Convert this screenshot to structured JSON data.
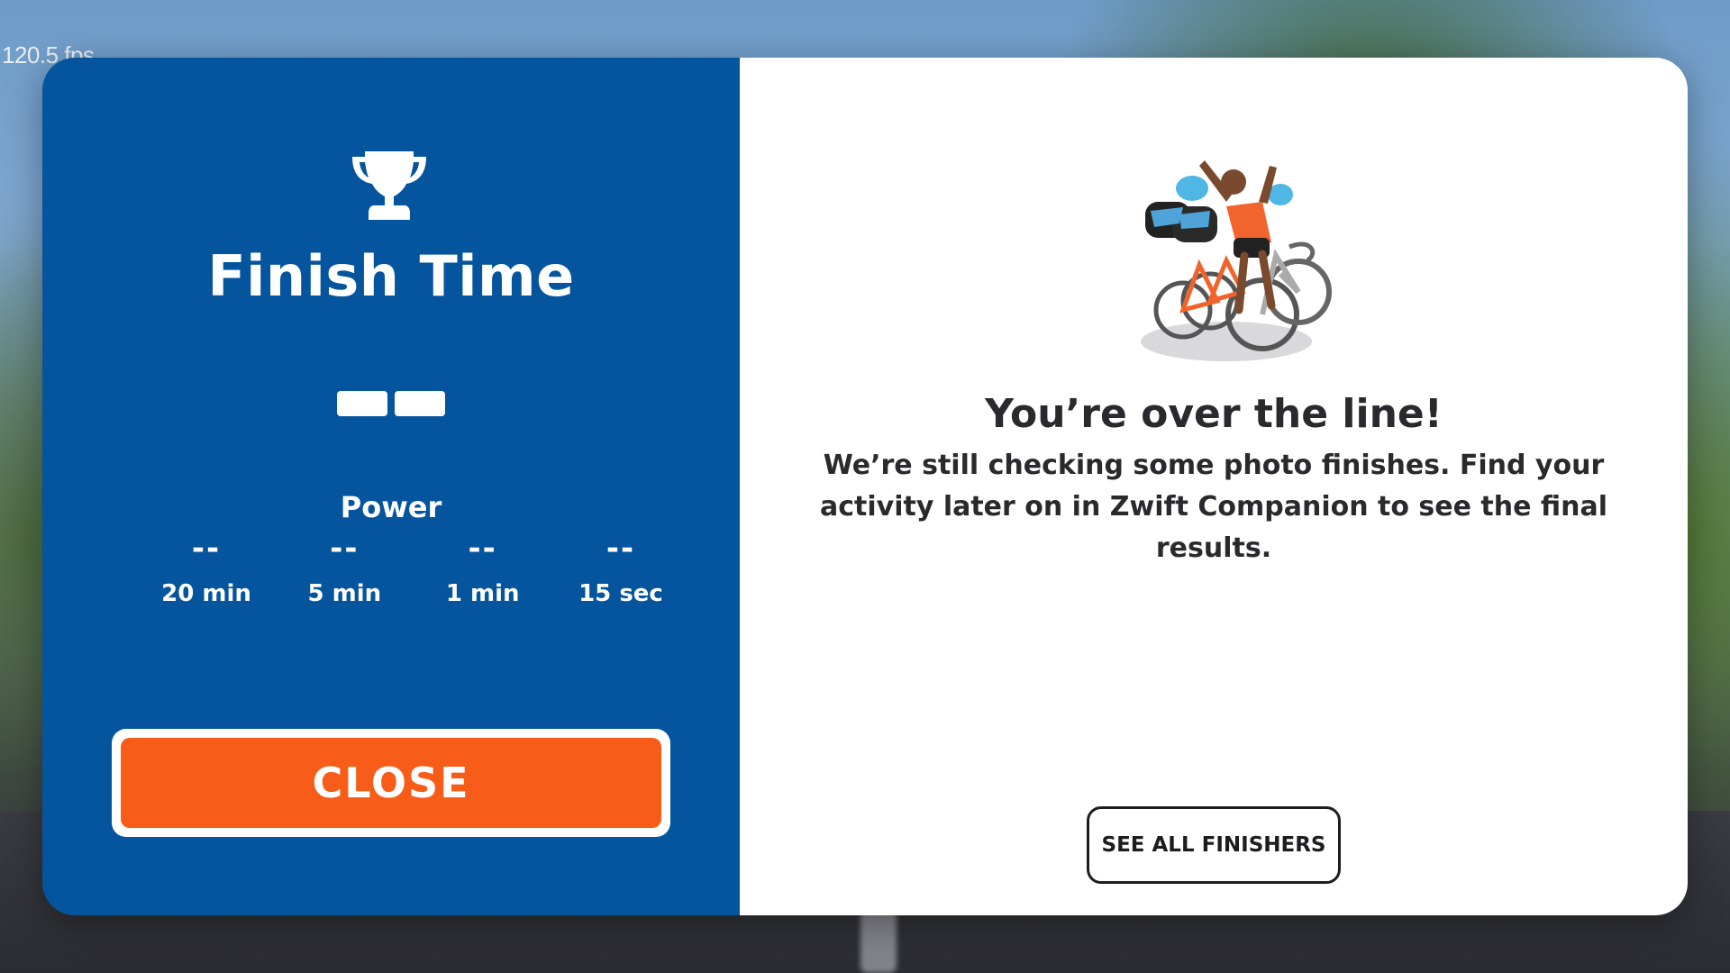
{
  "hud": {
    "fps": "120.5 fps"
  },
  "finish": {
    "title": "Finish Time",
    "trophy_icon": "trophy-icon",
    "time_value": "--"
  },
  "power": {
    "label": "Power",
    "items": [
      {
        "value": "--",
        "duration": "20 min"
      },
      {
        "value": "--",
        "duration": "5 min"
      },
      {
        "value": "--",
        "duration": "1 min"
      },
      {
        "value": "--",
        "duration": "15 sec"
      }
    ]
  },
  "buttons": {
    "close_label": "CLOSE",
    "see_all_label": "SEE ALL FINISHERS"
  },
  "result": {
    "headline": "You’re over the line!",
    "message": "We’re still checking some photo finishes. Find your activity later on in Zwift Companion to see the final results.",
    "illustration_icon": "cyclists-finish-illustration"
  },
  "colors": {
    "panel_blue": "#04559e",
    "accent_orange": "#f75c19",
    "text_dark": "#2a2a2e"
  }
}
